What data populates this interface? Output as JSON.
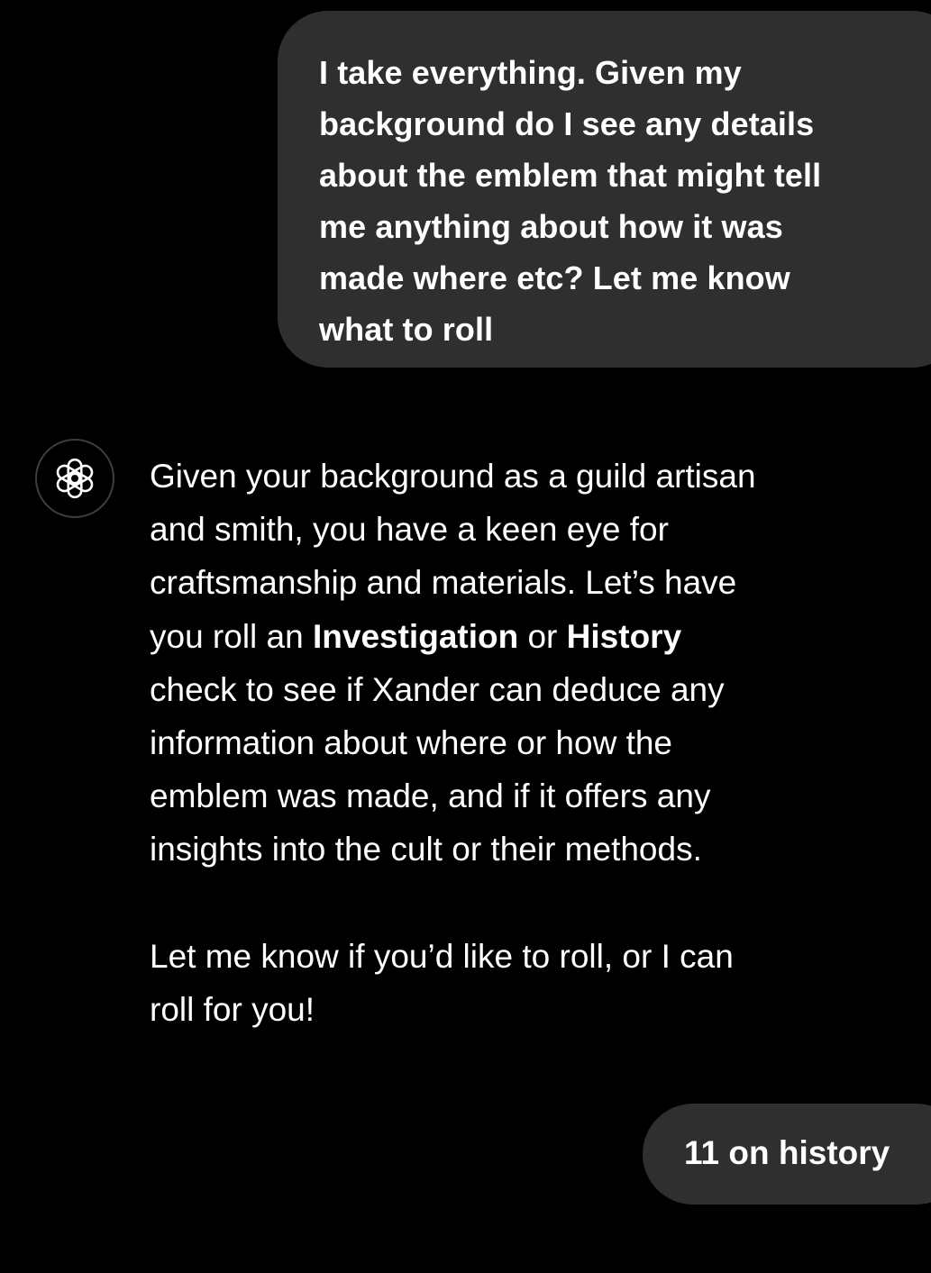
{
  "conversation": {
    "user_message_1": {
      "lines": [
        "I take everything. Given my",
        "background do I see any details",
        "about the emblem that might tell",
        "me anything about how it was",
        "made where etc? Let me know",
        "what to roll"
      ]
    },
    "assistant_message": {
      "avatar_icon": "openai-logo-icon",
      "para1_lines": [
        "Given your background as a guild artisan",
        "and smith, you have a keen eye for",
        "craftsmanship and materials. Let’s have"
      ],
      "para1_line4_prefix": "you roll an ",
      "bold_investigation": "Investigation",
      "para1_line4_mid": " or ",
      "bold_history": "History",
      "para1_rest_lines": [
        "check to see if Xander can deduce any",
        "information about where or how the",
        "emblem was made, and if it offers any",
        "insights into the cult or their methods."
      ],
      "para2_lines": [
        "Let me know if you’d like to roll, or I can",
        "roll for you!"
      ]
    },
    "user_message_2": {
      "text": "11 on history"
    }
  },
  "colors": {
    "background": "#000000",
    "bubble": "#2f2f2f",
    "text": "#ffffff",
    "avatar_border": "#3e3e3e"
  }
}
